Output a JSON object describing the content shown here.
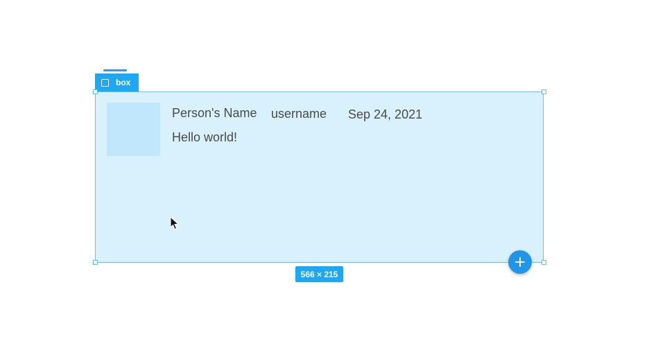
{
  "frame": {
    "tag_label": "box",
    "size_label": "566 × 215"
  },
  "card": {
    "name": "Person's Name",
    "username": "username",
    "date": "Sep 24, 2021",
    "message": "Hello world!"
  },
  "icons": {
    "frame_icon": "square-icon",
    "add_icon": "plus-icon",
    "cursor_icon": "arrow-cursor-icon"
  },
  "colors": {
    "accent": "#1ea7f2",
    "frame_fill": "#d9f1fc",
    "frame_border": "#5cc2ef",
    "avatar_fill": "#c0e7fc",
    "text": "#4a4a4a"
  }
}
